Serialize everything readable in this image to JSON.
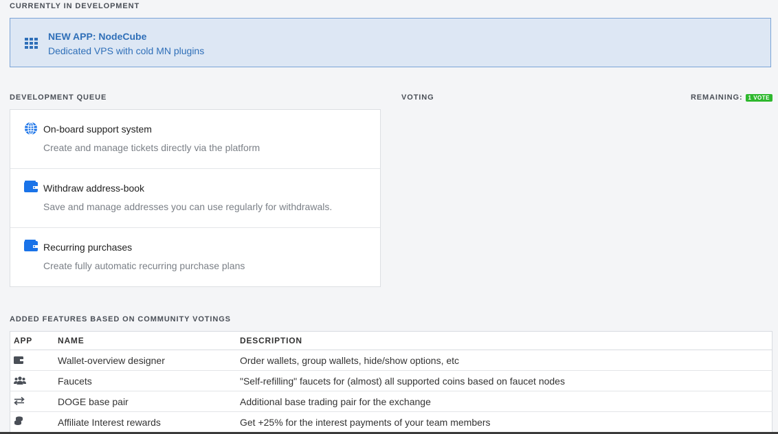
{
  "current": {
    "section_title": "CURRENTLY IN DEVELOPMENT",
    "title": "NEW APP: NodeCube",
    "subtitle": "Dedicated VPS with cold MN plugins",
    "icon": "grid-icon"
  },
  "queue": {
    "section_title": "DEVELOPMENT QUEUE",
    "items": [
      {
        "title": "On-board support system",
        "description": "Create and manage tickets directly via the platform",
        "icon": "globe-icon"
      },
      {
        "title": "Withdraw address-book",
        "description": "Save and manage addresses you can use regularly for withdrawals.",
        "icon": "wallet-icon"
      },
      {
        "title": "Recurring purchases",
        "description": "Create fully automatic recurring purchase plans",
        "icon": "wallet-icon"
      }
    ]
  },
  "voting": {
    "section_title": "VOTING",
    "remaining_label": "REMAINING:",
    "remaining_badge": "1 VOTE"
  },
  "features": {
    "section_title": "ADDED FEATURES BASED ON COMMUNITY VOTINGS",
    "columns": [
      "APP",
      "NAME",
      "DESCRIPTION"
    ],
    "rows": [
      {
        "icon": "wallet-icon",
        "name": "Wallet-overview designer",
        "description": "Order wallets, group wallets, hide/show options, etc"
      },
      {
        "icon": "users-icon",
        "name": "Faucets",
        "description": "\"Self-refilling\" faucets for (almost) all supported coins based on faucet nodes"
      },
      {
        "icon": "exchange-icon",
        "name": "DOGE base pair",
        "description": "Additional base trading pair for the exchange"
      },
      {
        "icon": "coins-icon",
        "name": "Affiliate Interest rewards",
        "description": "Get +25% for the interest payments of your team members"
      }
    ]
  },
  "colors": {
    "accent": "#2f6fb8",
    "badge": "#2eb82e",
    "icon_blue": "#1a73e8"
  }
}
